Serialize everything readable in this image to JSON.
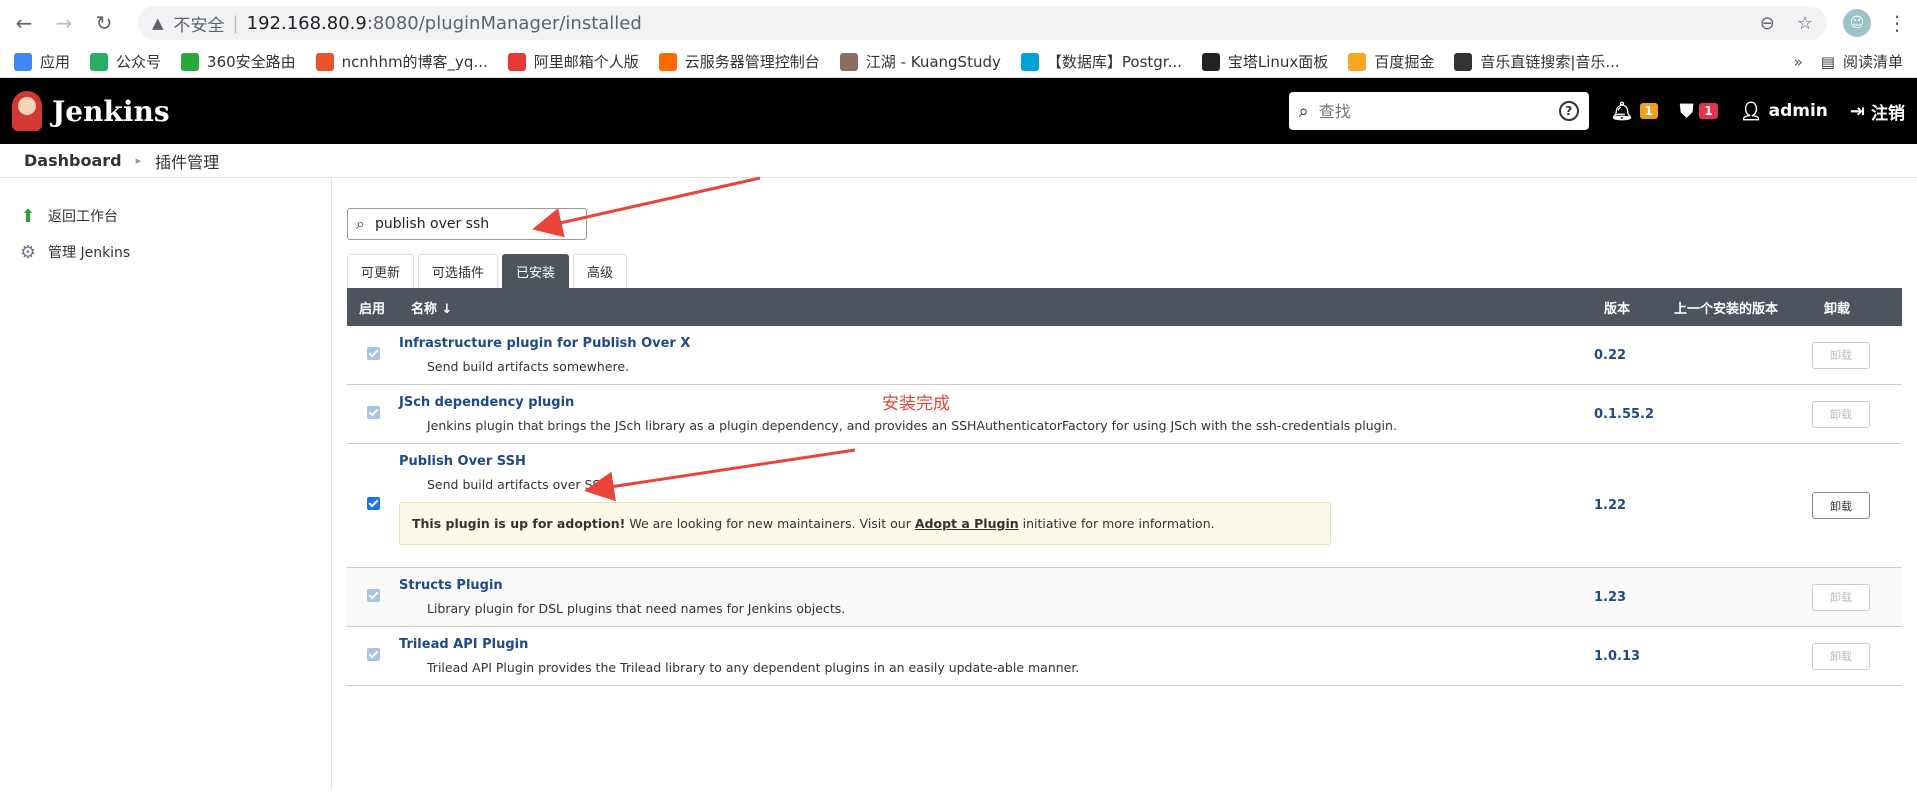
{
  "browser": {
    "insecure_label": "不安全",
    "url_host": "192.168.80.9",
    "url_rest": ":8080/pluginManager/installed",
    "bookmarks": [
      {
        "label": "应用",
        "color": "#4285f4"
      },
      {
        "label": "公众号",
        "color": "#2aae67"
      },
      {
        "label": "360安全路由",
        "color": "#2aa83a"
      },
      {
        "label": "ncnhhm的博客_yq...",
        "color": "#e8552a"
      },
      {
        "label": "阿里邮箱个人版",
        "color": "#e53935"
      },
      {
        "label": "云服务器管理控制台",
        "color": "#ff6a00"
      },
      {
        "label": "江湖 - KuangStudy",
        "color": "#8d6e63"
      },
      {
        "label": "【数据库】Postgr...",
        "color": "#00a1d6"
      },
      {
        "label": "宝塔Linux面板",
        "color": "#222222"
      },
      {
        "label": "百度掘金",
        "color": "#f5a623"
      },
      {
        "label": "音乐直链搜索|音乐...",
        "color": "#333333"
      }
    ],
    "more": "»",
    "reading_list": "阅读清单"
  },
  "header": {
    "brand": "Jenkins",
    "search_placeholder": "查找",
    "notifications_count": "1",
    "security_count": "1",
    "user": "admin",
    "logout": "注销"
  },
  "breadcrumb": {
    "root": "Dashboard",
    "current": "插件管理"
  },
  "sidebar": {
    "items": [
      {
        "label": "返回工作台",
        "icon": "up-arrow-icon"
      },
      {
        "label": "管理 Jenkins",
        "icon": "gear-icon"
      }
    ]
  },
  "filter": {
    "value": "publish over ssh"
  },
  "tabs": [
    {
      "label": "可更新",
      "active": false
    },
    {
      "label": "可选插件",
      "active": false
    },
    {
      "label": "已安装",
      "active": true
    },
    {
      "label": "高级",
      "active": false
    }
  ],
  "table": {
    "headers": {
      "enabled": "启用",
      "name": "名称 ↓",
      "version": "版本",
      "previous": "上一个安装的版本",
      "uninstall": "卸载"
    },
    "rows": [
      {
        "name": "Infrastructure plugin for Publish Over X",
        "desc": "Send build artifacts somewhere.",
        "version": "0.22",
        "uninstall": "卸载"
      },
      {
        "name": "JSch dependency plugin",
        "desc": "Jenkins plugin that brings the JSch library as a plugin dependency, and provides an SSHAuthenticatorFactory for using JSch with the ssh-credentials plugin.",
        "version": "0.1.55.2",
        "uninstall": "卸载"
      },
      {
        "name": "Publish Over SSH",
        "desc": "Send build artifacts over SSH",
        "version": "1.22",
        "uninstall": "卸载"
      },
      {
        "name": "Structs Plugin",
        "desc": "Library plugin for DSL plugins that need names for Jenkins objects.",
        "version": "1.23",
        "uninstall": "卸载"
      },
      {
        "name": "Trilead API Plugin",
        "desc": "Trilead API Plugin provides the Trilead library to any dependent plugins in an easily update-able manner.",
        "version": "1.0.13",
        "uninstall": "卸载"
      }
    ],
    "adoption": {
      "strong": "This plugin is up for adoption!",
      "text": "We are looking for new maintainers. Visit our",
      "link": "Adopt a Plugin",
      "tail": "initiative for more information."
    }
  },
  "annotation": {
    "text": "安装完成",
    "color": "#e8443a"
  }
}
